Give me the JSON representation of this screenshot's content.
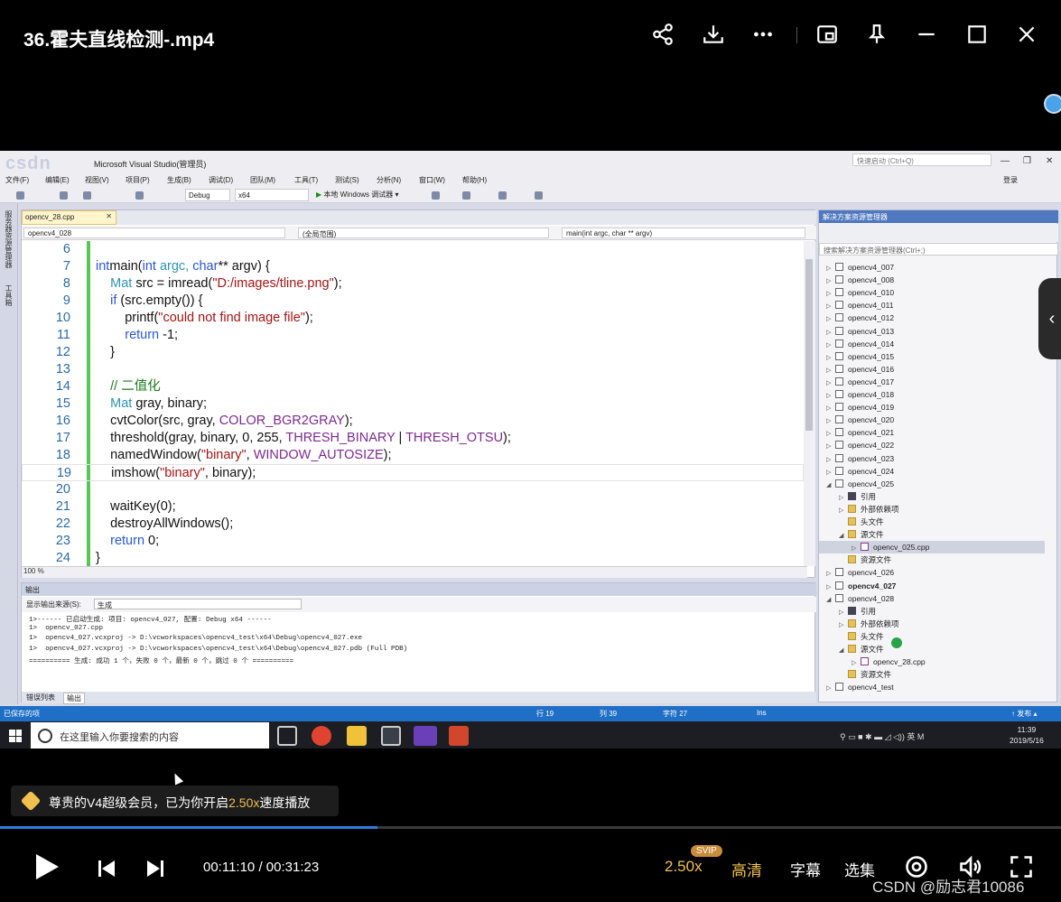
{
  "player": {
    "title": "36.霍夫直线检测-.mp4",
    "current_time": "00:11:10",
    "time_separator": " / ",
    "total_time": "00:31:23",
    "progress_fraction": 0.356,
    "speed": "2.50x",
    "svip_badge": "SVIP",
    "quality": "高清",
    "subtitle": "字幕",
    "episodes": "选集",
    "toast_prefix": "尊贵的V4超级会员，已为你开启",
    "toast_speed": "2.50x",
    "toast_suffix": "速度播放",
    "watermark": "CSDN @励志君10086",
    "accent_color": "#2c7fe0",
    "gold_color": "#f2c04e"
  },
  "vs": {
    "window_title": "Microsoft Visual Studio(管理员)",
    "logo_overlay": "csdn",
    "quick_launch": "快速启动 (Ctrl+Q)",
    "login": "登录",
    "menus": [
      "文件(F)",
      "编辑(E)",
      "视图(V)",
      "项目(P)",
      "生成(B)",
      "调试(D)",
      "团队(M)",
      "工具(T)",
      "测试(S)",
      "分析(N)",
      "窗口(W)",
      "帮助(H)"
    ],
    "config": "Debug",
    "platform": "x64",
    "run_label": "本地 Windows 调试器",
    "left_strip": [
      "服务器资源管理器",
      "工具箱"
    ],
    "editor_tab": "opencv_28.cpp",
    "nav_project": "opencv4_028",
    "nav_scope": "(全局范围)",
    "nav_function": "main(int argc, char ** argv)",
    "zoom": "100 %",
    "code_lines": [
      {
        "n": "6",
        "tokens": []
      },
      {
        "n": "7",
        "tokens": [
          [
            "kw",
            "int"
          ],
          [
            "",
            "main("
          ],
          [
            "kw",
            "int"
          ],
          [
            "cmx",
            " argc, "
          ],
          [
            "kw",
            "char"
          ],
          [
            "",
            "** argv) {"
          ]
        ]
      },
      {
        "n": "8",
        "tokens": [
          [
            "",
            "    "
          ],
          [
            "ty",
            "Mat"
          ],
          [
            "",
            " src = imread("
          ],
          [
            "str",
            "\"D:/images/tline.png\""
          ],
          [
            "",
            ");"
          ]
        ]
      },
      {
        "n": "9",
        "tokens": [
          [
            "",
            "    "
          ],
          [
            "kw",
            "if"
          ],
          [
            "",
            " (src.empty()) {"
          ]
        ]
      },
      {
        "n": "10",
        "tokens": [
          [
            "",
            "        printf("
          ],
          [
            "str",
            "\"could not find image file\""
          ],
          [
            "",
            ");"
          ]
        ]
      },
      {
        "n": "11",
        "tokens": [
          [
            "",
            "        "
          ],
          [
            "kw",
            "return"
          ],
          [
            "",
            " -1;"
          ]
        ]
      },
      {
        "n": "12",
        "tokens": [
          [
            "",
            "    }"
          ]
        ]
      },
      {
        "n": "13",
        "tokens": []
      },
      {
        "n": "14",
        "tokens": [
          [
            "",
            "    "
          ],
          [
            "cm",
            "// 二值化"
          ]
        ]
      },
      {
        "n": "15",
        "tokens": [
          [
            "",
            "    "
          ],
          [
            "ty",
            "Mat"
          ],
          [
            "",
            " gray, binary;"
          ]
        ]
      },
      {
        "n": "16",
        "tokens": [
          [
            "",
            "    cvtColor(src, gray, "
          ],
          [
            "mac",
            "COLOR_BGR2GRAY"
          ],
          [
            "",
            ");"
          ]
        ]
      },
      {
        "n": "17",
        "tokens": [
          [
            "",
            "    threshold(gray, binary, 0, 255, "
          ],
          [
            "mac",
            "THRESH_BINARY"
          ],
          [
            "",
            " | "
          ],
          [
            "mac",
            "THRESH_OTSU"
          ],
          [
            "",
            ");"
          ]
        ]
      },
      {
        "n": "18",
        "tokens": [
          [
            "",
            "    namedWindow("
          ],
          [
            "str",
            "\"binary\""
          ],
          [
            "",
            ", "
          ],
          [
            "mac",
            "WINDOW_AUTOSIZE"
          ],
          [
            "",
            ");"
          ]
        ]
      },
      {
        "n": "19",
        "tokens": [
          [
            "",
            "    imshow("
          ],
          [
            "str",
            "\"binary\""
          ],
          [
            "",
            ", binary);"
          ]
        ]
      },
      {
        "n": "20",
        "tokens": []
      },
      {
        "n": "21",
        "tokens": [
          [
            "",
            "    waitKey(0);"
          ]
        ]
      },
      {
        "n": "22",
        "tokens": [
          [
            "",
            "    destroyAllWindows();"
          ]
        ]
      },
      {
        "n": "23",
        "tokens": [
          [
            "",
            "    "
          ],
          [
            "kw",
            "return"
          ],
          [
            "",
            " 0;"
          ]
        ]
      },
      {
        "n": "24",
        "tokens": [
          [
            "",
            "}"
          ]
        ]
      }
    ],
    "output_title": "输出",
    "output_source_label": "显示输出来源(S):",
    "output_source_value": "生成",
    "output_lines": [
      "1>------ 已启动生成: 项目: opencv4_027, 配置: Debug x64 ------",
      "1>  opencv_027.cpp",
      "1>  opencv4_027.vcxproj -> D:\\vcworkspaces\\opencv4_test\\x64\\Debug\\opencv4_027.exe",
      "1>  opencv4_027.vcxproj -> D:\\vcworkspaces\\opencv4_test\\x64\\Debug\\opencv4_027.pdb (Full PDB)",
      "========== 生成: 成功 1 个，失败 0 个，最新 0 个，跳过 0 个 =========="
    ],
    "bottom_tabs": [
      "错误列表",
      "输出"
    ],
    "solution_title": "解决方案资源管理器",
    "solution_search": "搜索解决方案资源管理器(Ctrl+;)",
    "tree": [
      {
        "label": "opencv4_007",
        "depth": 0,
        "icon": "proj",
        "tw": "▷"
      },
      {
        "label": "opencv4_008",
        "depth": 0,
        "icon": "proj",
        "tw": "▷"
      },
      {
        "label": "opencv4_010",
        "depth": 0,
        "icon": "proj",
        "tw": "▷"
      },
      {
        "label": "opencv4_011",
        "depth": 0,
        "icon": "proj",
        "tw": "▷"
      },
      {
        "label": "opencv4_012",
        "depth": 0,
        "icon": "proj",
        "tw": "▷"
      },
      {
        "label": "opencv4_013",
        "depth": 0,
        "icon": "proj",
        "tw": "▷"
      },
      {
        "label": "opencv4_014",
        "depth": 0,
        "icon": "proj",
        "tw": "▷"
      },
      {
        "label": "opencv4_015",
        "depth": 0,
        "icon": "proj",
        "tw": "▷"
      },
      {
        "label": "opencv4_016",
        "depth": 0,
        "icon": "proj",
        "tw": "▷"
      },
      {
        "label": "opencv4_017",
        "depth": 0,
        "icon": "proj",
        "tw": "▷"
      },
      {
        "label": "opencv4_018",
        "depth": 0,
        "icon": "proj",
        "tw": "▷"
      },
      {
        "label": "opencv4_019",
        "depth": 0,
        "icon": "proj",
        "tw": "▷"
      },
      {
        "label": "opencv4_020",
        "depth": 0,
        "icon": "proj",
        "tw": "▷"
      },
      {
        "label": "opencv4_021",
        "depth": 0,
        "icon": "proj",
        "tw": "▷"
      },
      {
        "label": "opencv4_022",
        "depth": 0,
        "icon": "proj",
        "tw": "▷"
      },
      {
        "label": "opencv4_023",
        "depth": 0,
        "icon": "proj",
        "tw": "▷"
      },
      {
        "label": "opencv4_024",
        "depth": 0,
        "icon": "proj",
        "tw": "▷"
      },
      {
        "label": "opencv4_025",
        "depth": 0,
        "icon": "proj",
        "tw": "◢"
      },
      {
        "label": "引用",
        "depth": 1,
        "icon": "ref",
        "tw": "▷"
      },
      {
        "label": "外部依赖项",
        "depth": 1,
        "icon": "folder",
        "tw": "▷"
      },
      {
        "label": "头文件",
        "depth": 1,
        "icon": "folder",
        "tw": ""
      },
      {
        "label": "源文件",
        "depth": 1,
        "icon": "folder",
        "tw": "◢"
      },
      {
        "label": "opencv_025.cpp",
        "depth": 2,
        "icon": "cpp",
        "tw": "▷",
        "selected": true
      },
      {
        "label": "资源文件",
        "depth": 1,
        "icon": "folder",
        "tw": ""
      },
      {
        "label": "opencv4_026",
        "depth": 0,
        "icon": "proj",
        "tw": "▷"
      },
      {
        "label": "opencv4_027",
        "depth": 0,
        "icon": "proj",
        "tw": "▷",
        "bold": true
      },
      {
        "label": "opencv4_028",
        "depth": 0,
        "icon": "proj",
        "tw": "◢"
      },
      {
        "label": "引用",
        "depth": 1,
        "icon": "ref",
        "tw": "▷"
      },
      {
        "label": "外部依赖项",
        "depth": 1,
        "icon": "folder",
        "tw": "▷"
      },
      {
        "label": "头文件",
        "depth": 1,
        "icon": "folder",
        "tw": ""
      },
      {
        "label": "源文件",
        "depth": 1,
        "icon": "folder",
        "tw": "◢"
      },
      {
        "label": "opencv_28.cpp",
        "depth": 2,
        "icon": "cpp",
        "tw": "▷"
      },
      {
        "label": "资源文件",
        "depth": 1,
        "icon": "folder",
        "tw": ""
      },
      {
        "label": "opencv4_test",
        "depth": 0,
        "icon": "proj",
        "tw": "▷"
      }
    ],
    "status_left": "已保存的项",
    "status_row": "行 19",
    "status_col": "列 39",
    "status_char": "字符 27",
    "status_ins": "Ins",
    "status_publish": "↑ 发布 ▴"
  },
  "taskbar": {
    "search_placeholder": "在这里输入你要搜索的内容",
    "tray": "⚲  ▭ ■ ✱ ▬ ◿ ◁)) 英  M",
    "time": "11:39",
    "date": "2019/5/16"
  }
}
